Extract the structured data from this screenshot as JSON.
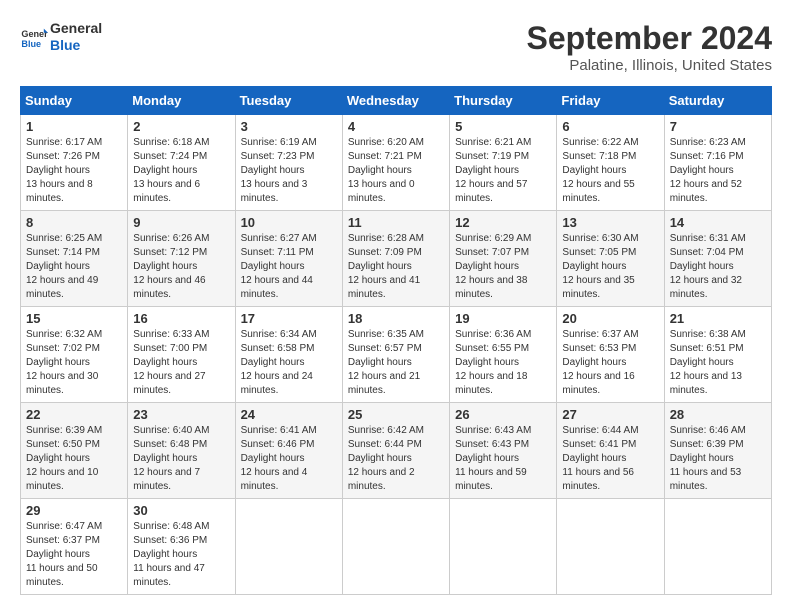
{
  "header": {
    "logo_line1": "General",
    "logo_line2": "Blue",
    "month_title": "September 2024",
    "location": "Palatine, Illinois, United States"
  },
  "weekdays": [
    "Sunday",
    "Monday",
    "Tuesday",
    "Wednesday",
    "Thursday",
    "Friday",
    "Saturday"
  ],
  "weeks": [
    [
      {
        "day": "1",
        "sunrise": "6:17 AM",
        "sunset": "7:26 PM",
        "daylight": "13 hours and 8 minutes."
      },
      {
        "day": "2",
        "sunrise": "6:18 AM",
        "sunset": "7:24 PM",
        "daylight": "13 hours and 6 minutes."
      },
      {
        "day": "3",
        "sunrise": "6:19 AM",
        "sunset": "7:23 PM",
        "daylight": "13 hours and 3 minutes."
      },
      {
        "day": "4",
        "sunrise": "6:20 AM",
        "sunset": "7:21 PM",
        "daylight": "13 hours and 0 minutes."
      },
      {
        "day": "5",
        "sunrise": "6:21 AM",
        "sunset": "7:19 PM",
        "daylight": "12 hours and 57 minutes."
      },
      {
        "day": "6",
        "sunrise": "6:22 AM",
        "sunset": "7:18 PM",
        "daylight": "12 hours and 55 minutes."
      },
      {
        "day": "7",
        "sunrise": "6:23 AM",
        "sunset": "7:16 PM",
        "daylight": "12 hours and 52 minutes."
      }
    ],
    [
      {
        "day": "8",
        "sunrise": "6:25 AM",
        "sunset": "7:14 PM",
        "daylight": "12 hours and 49 minutes."
      },
      {
        "day": "9",
        "sunrise": "6:26 AM",
        "sunset": "7:12 PM",
        "daylight": "12 hours and 46 minutes."
      },
      {
        "day": "10",
        "sunrise": "6:27 AM",
        "sunset": "7:11 PM",
        "daylight": "12 hours and 44 minutes."
      },
      {
        "day": "11",
        "sunrise": "6:28 AM",
        "sunset": "7:09 PM",
        "daylight": "12 hours and 41 minutes."
      },
      {
        "day": "12",
        "sunrise": "6:29 AM",
        "sunset": "7:07 PM",
        "daylight": "12 hours and 38 minutes."
      },
      {
        "day": "13",
        "sunrise": "6:30 AM",
        "sunset": "7:05 PM",
        "daylight": "12 hours and 35 minutes."
      },
      {
        "day": "14",
        "sunrise": "6:31 AM",
        "sunset": "7:04 PM",
        "daylight": "12 hours and 32 minutes."
      }
    ],
    [
      {
        "day": "15",
        "sunrise": "6:32 AM",
        "sunset": "7:02 PM",
        "daylight": "12 hours and 30 minutes."
      },
      {
        "day": "16",
        "sunrise": "6:33 AM",
        "sunset": "7:00 PM",
        "daylight": "12 hours and 27 minutes."
      },
      {
        "day": "17",
        "sunrise": "6:34 AM",
        "sunset": "6:58 PM",
        "daylight": "12 hours and 24 minutes."
      },
      {
        "day": "18",
        "sunrise": "6:35 AM",
        "sunset": "6:57 PM",
        "daylight": "12 hours and 21 minutes."
      },
      {
        "day": "19",
        "sunrise": "6:36 AM",
        "sunset": "6:55 PM",
        "daylight": "12 hours and 18 minutes."
      },
      {
        "day": "20",
        "sunrise": "6:37 AM",
        "sunset": "6:53 PM",
        "daylight": "12 hours and 16 minutes."
      },
      {
        "day": "21",
        "sunrise": "6:38 AM",
        "sunset": "6:51 PM",
        "daylight": "12 hours and 13 minutes."
      }
    ],
    [
      {
        "day": "22",
        "sunrise": "6:39 AM",
        "sunset": "6:50 PM",
        "daylight": "12 hours and 10 minutes."
      },
      {
        "day": "23",
        "sunrise": "6:40 AM",
        "sunset": "6:48 PM",
        "daylight": "12 hours and 7 minutes."
      },
      {
        "day": "24",
        "sunrise": "6:41 AM",
        "sunset": "6:46 PM",
        "daylight": "12 hours and 4 minutes."
      },
      {
        "day": "25",
        "sunrise": "6:42 AM",
        "sunset": "6:44 PM",
        "daylight": "12 hours and 2 minutes."
      },
      {
        "day": "26",
        "sunrise": "6:43 AM",
        "sunset": "6:43 PM",
        "daylight": "11 hours and 59 minutes."
      },
      {
        "day": "27",
        "sunrise": "6:44 AM",
        "sunset": "6:41 PM",
        "daylight": "11 hours and 56 minutes."
      },
      {
        "day": "28",
        "sunrise": "6:46 AM",
        "sunset": "6:39 PM",
        "daylight": "11 hours and 53 minutes."
      }
    ],
    [
      {
        "day": "29",
        "sunrise": "6:47 AM",
        "sunset": "6:37 PM",
        "daylight": "11 hours and 50 minutes."
      },
      {
        "day": "30",
        "sunrise": "6:48 AM",
        "sunset": "6:36 PM",
        "daylight": "11 hours and 47 minutes."
      },
      null,
      null,
      null,
      null,
      null
    ]
  ]
}
